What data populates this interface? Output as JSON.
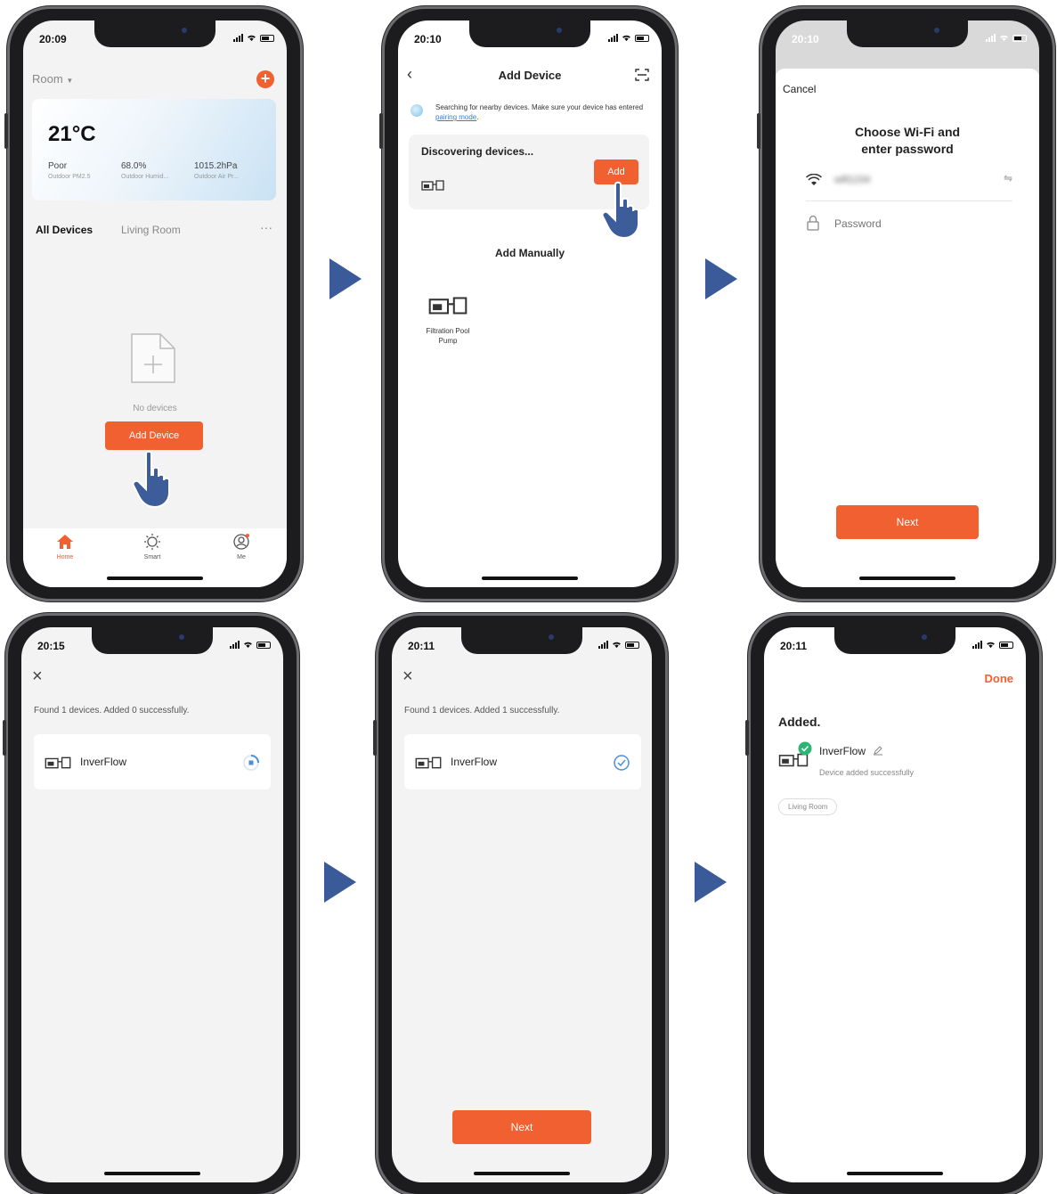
{
  "colors": {
    "accent": "#f06030",
    "arrow": "#3a5a9a",
    "check": "#4a90d9",
    "success": "#2bb673"
  },
  "screen1": {
    "time": "20:09",
    "room_label": "Room",
    "temperature": "21°C",
    "stats": [
      {
        "value": "Poor",
        "label": "Outdoor PM2.5"
      },
      {
        "value": "68.0%",
        "label": "Outdoor Humid..."
      },
      {
        "value": "1015.2hPa",
        "label": "Outdoor Air Pr..."
      }
    ],
    "tabs": {
      "all": "All Devices",
      "living": "Living Room"
    },
    "empty_text": "No devices",
    "add_button": "Add Device",
    "nav": {
      "home": "Home",
      "smart": "Smart",
      "me": "Me"
    }
  },
  "screen2": {
    "time": "20:10",
    "title": "Add Device",
    "search_text": "Searching for nearby devices. Make sure your device has entered",
    "search_link": "pairing mode",
    "discover_title": "Discovering devices...",
    "add_button": "Add",
    "manual_title": "Add Manually",
    "manual_item": "Filtration Pool Pump"
  },
  "screen3": {
    "time": "20:10",
    "cancel": "Cancel",
    "title_line1": "Choose Wi-Fi and",
    "title_line2": "enter password",
    "wifi_name": "wifi1234",
    "password_placeholder": "Password",
    "next_button": "Next"
  },
  "screen4": {
    "time": "20:15",
    "found_text": "Found 1 devices. Added 0 successfully.",
    "device_name": "InverFlow"
  },
  "screen5": {
    "time": "20:11",
    "found_text": "Found 1 devices. Added 1 successfully.",
    "device_name": "InverFlow",
    "next_button": "Next"
  },
  "screen6": {
    "time": "20:11",
    "done": "Done",
    "added_title": "Added.",
    "device_name": "InverFlow",
    "device_status": "Device added successfully",
    "room_chip": "Living Room"
  }
}
